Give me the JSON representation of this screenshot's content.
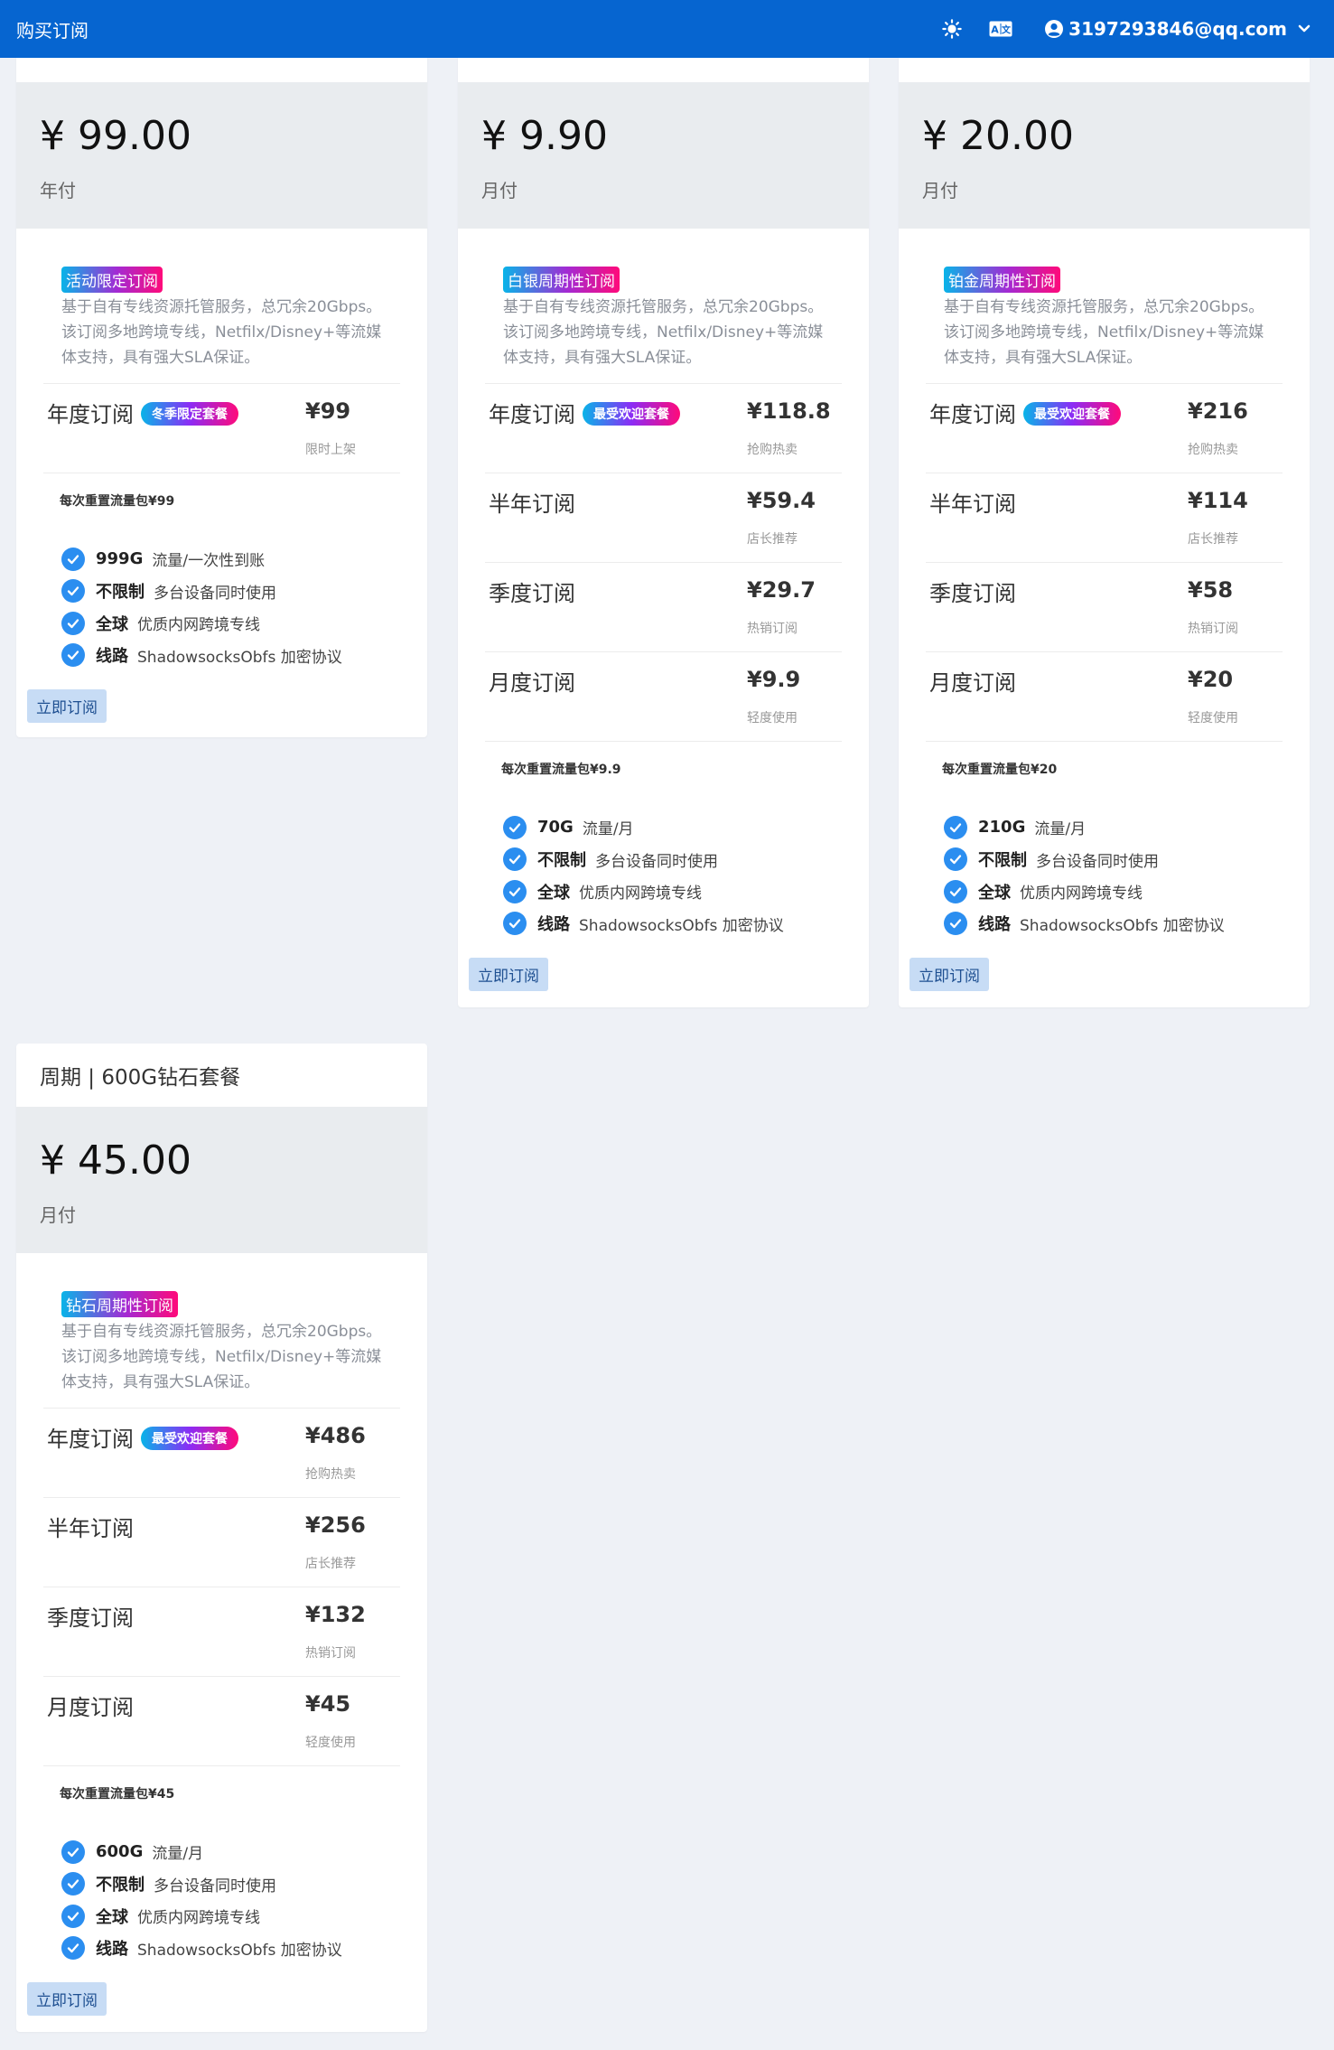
{
  "topbar": {
    "title": "购买订阅",
    "user_email": "3197293846@qq.com"
  },
  "cards": [
    {
      "header": "",
      "price": "¥ 99.00",
      "period": "年付",
      "badge": "活动限定订阅",
      "description": "基于自有专线资源托管服务，总冗余20Gbps。该订阅多地跨境专线，Netfilx/Disney+等流媒体支持，具有强大SLA保证。",
      "plans": [
        {
          "name": "年度订阅",
          "tag": "冬季限定套餐",
          "price": "¥99",
          "sub": "限时上架"
        }
      ],
      "reset": "每次重置流量包¥99",
      "features": [
        {
          "key": "999G",
          "text": "流量/一次性到账"
        },
        {
          "key": "不限制",
          "text": "多台设备同时使用"
        },
        {
          "key": "全球",
          "text": "优质内网跨境专线"
        },
        {
          "key": "线路",
          "text": "ShadowsocksObfs 加密协议"
        }
      ],
      "buy_label": "立即订阅"
    },
    {
      "header": "",
      "price": "¥ 9.90",
      "period": "月付",
      "badge": "白银周期性订阅",
      "description": "基于自有专线资源托管服务，总冗余20Gbps。该订阅多地跨境专线，Netfilx/Disney+等流媒体支持，具有强大SLA保证。",
      "plans": [
        {
          "name": "年度订阅",
          "tag": "最受欢迎套餐",
          "price": "¥118.8",
          "sub": "抢购热卖"
        },
        {
          "name": "半年订阅",
          "tag": "",
          "price": "¥59.4",
          "sub": "店长推荐"
        },
        {
          "name": "季度订阅",
          "tag": "",
          "price": "¥29.7",
          "sub": "热销订阅"
        },
        {
          "name": "月度订阅",
          "tag": "",
          "price": "¥9.9",
          "sub": "轻度使用"
        }
      ],
      "reset": "每次重置流量包¥9.9",
      "features": [
        {
          "key": "70G",
          "text": "流量/月"
        },
        {
          "key": "不限制",
          "text": "多台设备同时使用"
        },
        {
          "key": "全球",
          "text": "优质内网跨境专线"
        },
        {
          "key": "线路",
          "text": "ShadowsocksObfs 加密协议"
        }
      ],
      "buy_label": "立即订阅"
    },
    {
      "header": "",
      "price": "¥ 20.00",
      "period": "月付",
      "badge": "铂金周期性订阅",
      "description": "基于自有专线资源托管服务，总冗余20Gbps。该订阅多地跨境专线，Netfilx/Disney+等流媒体支持，具有强大SLA保证。",
      "plans": [
        {
          "name": "年度订阅",
          "tag": "最受欢迎套餐",
          "price": "¥216",
          "sub": "抢购热卖"
        },
        {
          "name": "半年订阅",
          "tag": "",
          "price": "¥114",
          "sub": "店长推荐"
        },
        {
          "name": "季度订阅",
          "tag": "",
          "price": "¥58",
          "sub": "热销订阅"
        },
        {
          "name": "月度订阅",
          "tag": "",
          "price": "¥20",
          "sub": "轻度使用"
        }
      ],
      "reset": "每次重置流量包¥20",
      "features": [
        {
          "key": "210G",
          "text": "流量/月"
        },
        {
          "key": "不限制",
          "text": "多台设备同时使用"
        },
        {
          "key": "全球",
          "text": "优质内网跨境专线"
        },
        {
          "key": "线路",
          "text": "ShadowsocksObfs 加密协议"
        }
      ],
      "buy_label": "立即订阅"
    },
    {
      "header": "周期 | 600G钻石套餐",
      "price": "¥ 45.00",
      "period": "月付",
      "badge": "钻石周期性订阅",
      "description": "基于自有专线资源托管服务，总冗余20Gbps。该订阅多地跨境专线，Netfilx/Disney+等流媒体支持，具有强大SLA保证。",
      "plans": [
        {
          "name": "年度订阅",
          "tag": "最受欢迎套餐",
          "price": "¥486",
          "sub": "抢购热卖"
        },
        {
          "name": "半年订阅",
          "tag": "",
          "price": "¥256",
          "sub": "店长推荐"
        },
        {
          "name": "季度订阅",
          "tag": "",
          "price": "¥132",
          "sub": "热销订阅"
        },
        {
          "name": "月度订阅",
          "tag": "",
          "price": "¥45",
          "sub": "轻度使用"
        }
      ],
      "reset": "每次重置流量包¥45",
      "features": [
        {
          "key": "600G",
          "text": "流量/月"
        },
        {
          "key": "不限制",
          "text": "多台设备同时使用"
        },
        {
          "key": "全球",
          "text": "优质内网跨境专线"
        },
        {
          "key": "线路",
          "text": "ShadowsocksObfs 加密协议"
        }
      ],
      "buy_label": "立即订阅"
    }
  ]
}
